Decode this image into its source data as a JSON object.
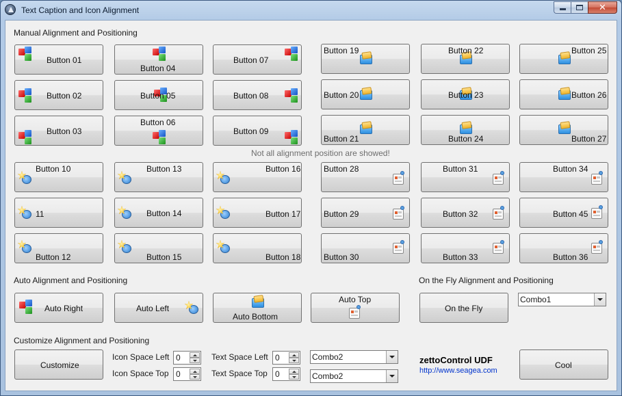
{
  "window": {
    "title": "Text Caption and Icon Alignment"
  },
  "sections": {
    "manual": "Manual Alignment and Positioning",
    "auto": "Auto Alignment and Positioning",
    "fly": "On the Fly Alignment and Positioning",
    "customize": "Customize Alignment and Positioning"
  },
  "note": "Not all alignment position are showed!",
  "buttons": {
    "b01": "Button 01",
    "b02": "Button 02",
    "b03": "Button 03",
    "b04": "Button 04",
    "b05": "Button 05",
    "b06": "Button 06",
    "b07": "Button 07",
    "b08": "Button 08",
    "b09": "Button 09",
    "b19": "Button 19",
    "b20": "Button 20",
    "b21": "Button 21",
    "b22": "Button 22",
    "b23": "Button 23",
    "b24": "Button 24",
    "b25": "Button 25",
    "b26": "Button 26",
    "b27": "Button 27",
    "b10": "Button 10",
    "b11": "11",
    "b12": "Button 12",
    "b13": "Button 13",
    "b14": "Button 14",
    "b15": "Button 15",
    "b16": "Button 16",
    "b17": "Button 17",
    "b18": "Button 18",
    "b28": "Button 28",
    "b29": "Button 29",
    "b30": "Button 30",
    "b31": "Button 31",
    "b32": "Button 32",
    "b33": "Button 33",
    "b34": "Button 34",
    "b45": "Button 45",
    "b36": "Button 36",
    "auto_right": "Auto Right",
    "auto_left": "Auto Left",
    "auto_bottom": "Auto Bottom",
    "auto_top": "Auto Top",
    "on_the_fly": "On the Fly",
    "customize": "Customize",
    "cool": "Cool"
  },
  "fly_combo": {
    "value": "Combo1"
  },
  "custom": {
    "icon_space_left_label": "Icon Space Left",
    "icon_space_left": "0",
    "icon_space_top_label": "Icon Space Top",
    "icon_space_top": "0",
    "text_space_left_label": "Text Space Left",
    "text_space_left": "0",
    "text_space_top_label": "Text Space Top",
    "text_space_top": "0",
    "combo_a": "Combo2",
    "combo_b": "Combo2"
  },
  "brand": {
    "name": "zettoControl UDF",
    "url": "http://www.seagea.com"
  },
  "icons": {
    "cubes": "cubes-icon",
    "folder": "folder-icon",
    "gear": "gear-icon",
    "sheet": "form-icon"
  }
}
